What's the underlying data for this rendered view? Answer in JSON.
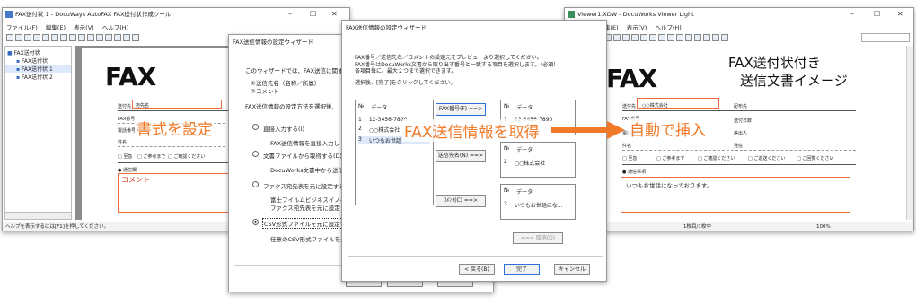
{
  "left_window": {
    "title": "FAX送付状 1 - DocuWays AutoFAX FAX送付状作成ツール",
    "menu": [
      "ファイル(F)",
      "編集(E)",
      "表示(V)",
      "ヘルプ(H)"
    ],
    "tree": [
      "FAX送付状",
      "FAX送付状",
      "FAX送付状 1",
      "FAX送付状 2"
    ],
    "status": "ヘルプを表示するには[F1]を押してください。",
    "doc": {
      "logo": "FAX",
      "to_label": "送付先",
      "to_value": "宛先名",
      "fax_label": "FAX番号",
      "phone_label": "電話番号",
      "subject_label": "件名",
      "check1": "□ 至急",
      "check2": "□ ご参考まで",
      "check3": "□ ご確認ください",
      "comment_header": "● 通信欄",
      "comment": "コメント"
    }
  },
  "wizard1": {
    "title": "FAX送信情報の設定ウィザード",
    "intro": "このウィザードでは、FAX送信に関する以下",
    "item1": "①送信先名（名称／所属）",
    "item2": "②コメント",
    "prompt": "FAX送信情報の設定方法を選択後、",
    "opt1": "直接入力する(I)",
    "opt1_sub": "FAX送信情報を直接入力し",
    "opt2": "文書ファイルから取得する(D)",
    "opt2_sub": "DocuWorks文書中から送信",
    "opt3": "ファクス宛先表を元に設定する(F)",
    "opt3_sub1": "富士フイルムビジネスイノベー",
    "opt3_sub2": "ファクス宛先表を元に設定し",
    "opt4": "CSV形式ファイルを元に設定する(",
    "opt4_sub": "任意のCSV形式ファイルを元"
  },
  "wizard2": {
    "title": "FAX送信情報の設定ウィザード",
    "desc1": "FAX番号／送信先名／コメントの設定元をプレビューより選択してください。",
    "desc2": "FAX番号はDocuWorks文書から取り出す番号と一致する項目を選択します。（必須）",
    "desc3": "各項目毎に、最大２つまで選択できます。",
    "desc4": "選択後、[完了]をクリックしてください。",
    "list_header_no": "№",
    "list_header_data": "データ",
    "list_rows": [
      {
        "no": "1",
        "data": "12-3456-7890"
      },
      {
        "no": "2",
        "data": "○○株式会社"
      },
      {
        "no": "3",
        "data": "いつもお世話"
      }
    ],
    "btn_fax": "FAX番号(F) ==>",
    "btn_name": "送信先名(N) ==>",
    "btn_comment": "ｺﾒﾝﾄ(C) ==>",
    "fax_box": {
      "no": "1",
      "data": "12-3456-7890"
    },
    "name_box": {
      "no": "2",
      "data": "○○株式会社"
    },
    "comment_box": {
      "no": "3",
      "data": "いつもお世話にな..."
    },
    "btn_remove": "<== 取消(D)",
    "btn_back": "< 戻る(B)",
    "btn_finish": "完了",
    "btn_cancel": "キャンセル"
  },
  "right_window": {
    "title": "Viewer1.XDW - DocuWorks Viewer Light",
    "menu": [
      "集(E)",
      "表示(V)",
      "ヘルプ(H)"
    ],
    "status_page": "1枚目/1枚中",
    "status_zoom": "100%",
    "doc": {
      "logo": "FAX",
      "heading1": "FAX送付状付き",
      "heading2": "送信文書イメージ",
      "to_label": "送付先",
      "to_value": "○○株式会社",
      "fax_label": "FAX番号",
      "phone_label": "電話番号",
      "subject_label": "件名",
      "date_label": "送付日数",
      "from_label": "差出人",
      "from_label2": "発信",
      "pages_label": "配布先",
      "check1": "□ 至急",
      "check2": "□ ご参考まで",
      "check3": "□ ご確認ください",
      "check4": "□ ご返送ください",
      "check5": "□ ご回覧ください",
      "comment_header": "● 通信事項",
      "comment": "いつもお世話になっております。"
    }
  },
  "annotations": {
    "format": "書式を設定",
    "acquire": "FAX送信情報を取得",
    "insert": "自動で挿入",
    "accent_red": "#d9331c",
    "accent_orange": "#f07a27"
  }
}
